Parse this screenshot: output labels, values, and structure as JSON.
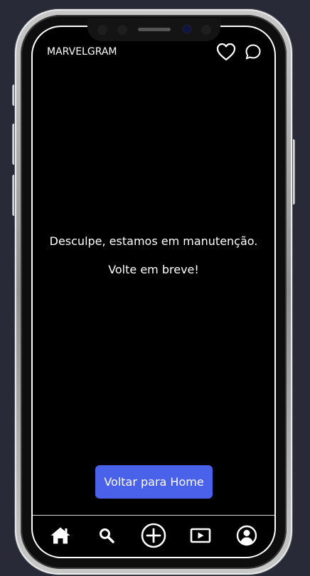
{
  "app": {
    "brand": "MARVELGRAM"
  },
  "header": {
    "icons": [
      "heart-icon",
      "chat-bubble-icon"
    ]
  },
  "maintenance": {
    "line1": "Desculpe, estamos em manutenção.",
    "line2": "Volte em breve!"
  },
  "actions": {
    "home_button_label": "Voltar para Home"
  },
  "bottom_nav": {
    "items": [
      "home-icon",
      "search-icon",
      "add-post-icon",
      "video-icon",
      "profile-icon"
    ]
  },
  "colors": {
    "background": "#282a37",
    "screen": "#000000",
    "accent": "#4a61ea",
    "text": "#ffffff"
  }
}
